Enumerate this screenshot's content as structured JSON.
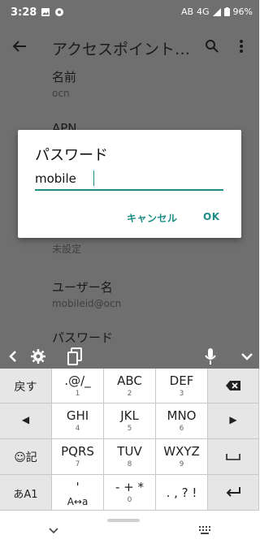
{
  "status_bar": {
    "time": "3:28",
    "network": "AB",
    "signal": "4G",
    "battery": "96%"
  },
  "app_bar": {
    "title": "アクセスポイント…"
  },
  "settings": [
    {
      "title": "名前",
      "summary": "ocn"
    },
    {
      "title": "APN",
      "summary": ""
    },
    {
      "title": "",
      "summary": "未設定"
    },
    {
      "title": "ユーザー名",
      "summary": "mobileid@ocn"
    },
    {
      "title": "パスワード",
      "summary": ""
    }
  ],
  "dialog": {
    "title": "パスワード",
    "value": "mobile",
    "cancel": "キャンセル",
    "ok": "OK"
  },
  "keyboard": {
    "rows": [
      {
        "left": "戻す",
        "keys": [
          {
            "main": ".@/_",
            "sub": "1"
          },
          {
            "main": "ABC",
            "sub": "2"
          },
          {
            "main": "DEF",
            "sub": "3"
          }
        ],
        "right": "backspace"
      },
      {
        "left": "◀",
        "keys": [
          {
            "main": "GHI",
            "sub": "4"
          },
          {
            "main": "JKL",
            "sub": "5"
          },
          {
            "main": "MNO",
            "sub": "6"
          }
        ],
        "right": "▶"
      },
      {
        "left": "☺記",
        "keys": [
          {
            "main": "PQRS",
            "sub": "7"
          },
          {
            "main": "TUV",
            "sub": "8"
          },
          {
            "main": "WXYZ",
            "sub": "9"
          }
        ],
        "right": "space"
      },
      {
        "left": "あA1",
        "keys": [
          {
            "main": "'",
            "sub": "A↔a"
          },
          {
            "main": "- + *",
            "sub": "0"
          },
          {
            "main": ". , ? !",
            "sub": ""
          }
        ],
        "right": "enter"
      }
    ]
  },
  "icons": {
    "back": "arrow-left-icon",
    "search": "search-icon",
    "more": "more-vert-icon",
    "kb_collapse": "chevron-left-icon",
    "kb_settings": "gear-icon",
    "kb_clipboard": "clipboard-icon",
    "kb_mic": "mic-icon",
    "kb_hide": "chevron-down-icon"
  },
  "colors": {
    "accent": "#1d8c85",
    "scrim": "#6f6f6f",
    "key": "#ffffff",
    "key_side": "#e6e6e6"
  }
}
